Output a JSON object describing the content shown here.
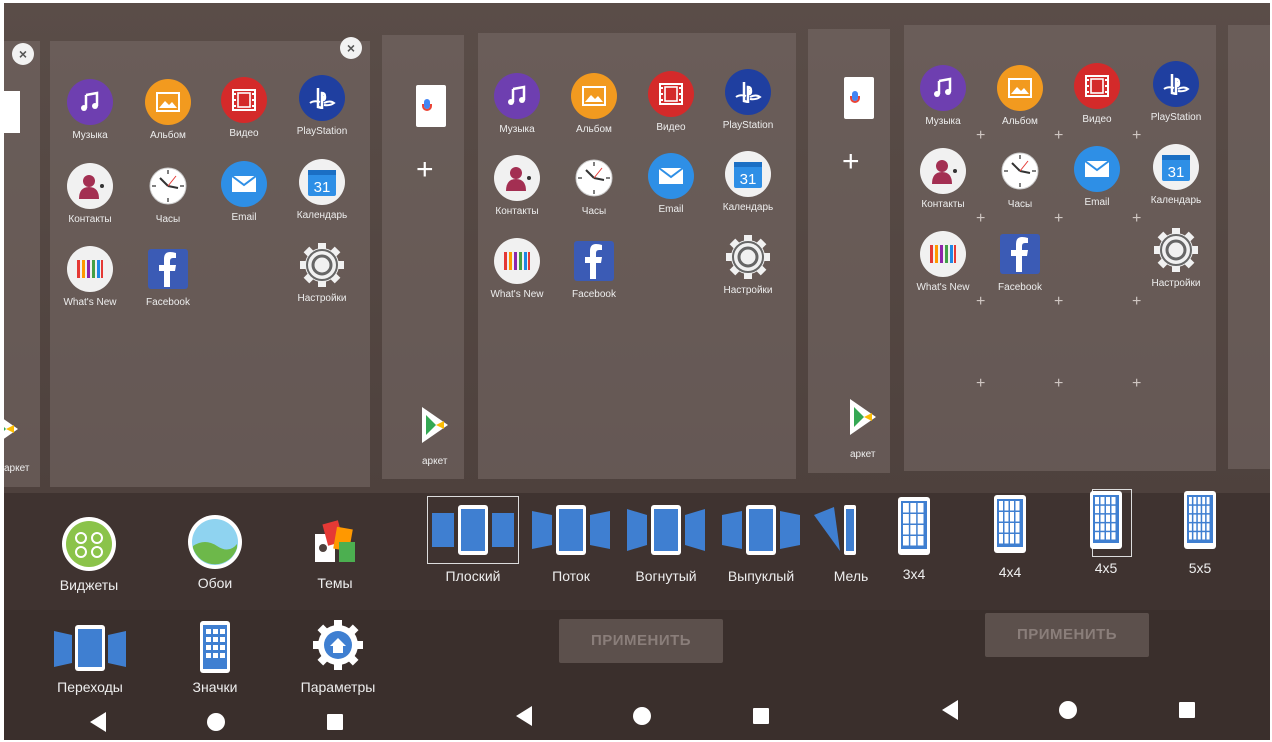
{
  "home_panels": {
    "apps": [
      {
        "label": "Музыка",
        "icon": "music-icon",
        "color": "#6e3fb0"
      },
      {
        "label": "Альбом",
        "icon": "album-icon",
        "color": "#f29a1f"
      },
      {
        "label": "Видео",
        "icon": "video-icon",
        "color": "#d42a2a"
      },
      {
        "label": "PlayStation",
        "icon": "playstation-icon",
        "color": "#1f3fa0"
      },
      {
        "label": "Контакты",
        "icon": "contacts-icon",
        "color": "#f1f1f1"
      },
      {
        "label": "Часы",
        "icon": "clock-icon",
        "color": "#f1f1f1"
      },
      {
        "label": "Email",
        "icon": "email-icon",
        "color": "#2e8fe6"
      },
      {
        "label": "Календарь",
        "icon": "calendar-icon",
        "color": "#f1f1f1"
      },
      {
        "label": "What's New",
        "icon": "whats-new-icon",
        "color": "#f1f1f1"
      },
      {
        "label": "Facebook",
        "icon": "facebook-icon",
        "color": "#3b5bb5"
      },
      {
        "label": "Настройки",
        "icon": "settings-icon",
        "color": "#f1f1f1"
      }
    ],
    "calendar_day": "31",
    "market_label_left": "аркет",
    "market_label": "аркет",
    "close_symbol": "×",
    "add_symbol": "+"
  },
  "settings_menu": {
    "items": [
      {
        "label": "Виджеты",
        "icon": "widgets-icon"
      },
      {
        "label": "Обои",
        "icon": "wallpaper-icon"
      },
      {
        "label": "Темы",
        "icon": "themes-icon"
      },
      {
        "label": "Переходы",
        "icon": "transitions-icon"
      },
      {
        "label": "Значки",
        "icon": "icons-grid-icon"
      },
      {
        "label": "Параметры",
        "icon": "home-settings-icon"
      }
    ]
  },
  "transitions": {
    "options": [
      "Плоский",
      "Поток",
      "Вогнутый",
      "Выпуклый",
      "Мель"
    ],
    "selected": "Плоский",
    "apply_label": "ПРИМЕНИТЬ"
  },
  "grid_sizes": {
    "options": [
      "3x4",
      "4x4",
      "4x5",
      "5x5"
    ],
    "selected": "4x5",
    "apply_label": "ПРИМЕНИТЬ"
  },
  "colors": {
    "accent_blue": "#3f7fd1",
    "screen_bg": "#4a3c38"
  }
}
